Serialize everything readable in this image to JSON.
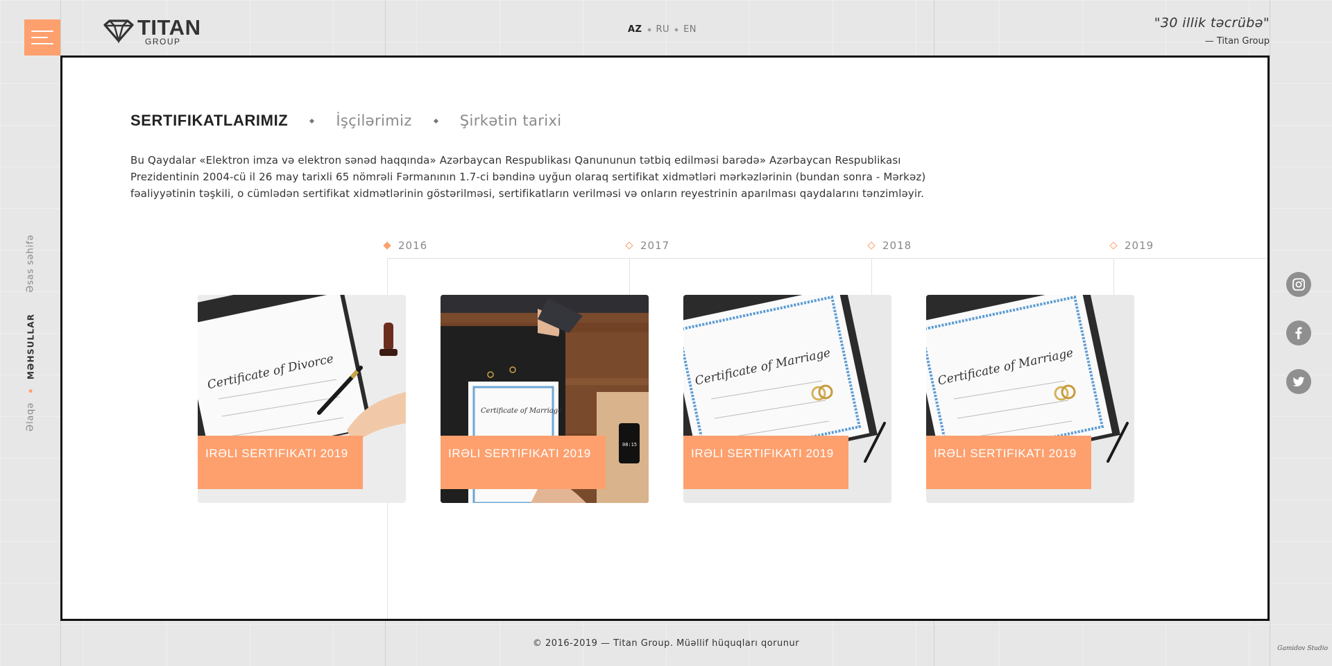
{
  "header": {
    "logo_main": "TITAN",
    "logo_sub": "GROUP",
    "languages": [
      {
        "code": "AZ",
        "active": true
      },
      {
        "code": "RU",
        "active": false
      },
      {
        "code": "EN",
        "active": false
      }
    ],
    "quote": "\"30 illik təcrübə\"",
    "quote_author": "— Titan Group"
  },
  "side_nav": {
    "items": [
      "Əsas səhifə",
      "MƏHSULLAR",
      "Əlaqə"
    ],
    "active_index": 1
  },
  "tabs": [
    "SERTIFIKATLARIMIZ",
    "İşçilərimiz",
    "Şirkətin tarixi"
  ],
  "description": "Bu Qaydalar «Elektron imza və elektron sənəd haqqında» Azərbaycan Respublikası Qanununun tətbiq edilməsi barədə» Azərbaycan Respublikası Prezidentinin 2004-cü il 26 may tarixli 65 nömrəli Fərmanının 1.7-ci bəndinə uyğun olaraq sertifikat xidmətləri mərkəzlərinin (bundan sonra - Mərkəz) fəaliyyətinin təşkili, o cümlədən sertifikat xidmətlərinin göstərilməsi, sertifikatların verilməsi və onların reyestrinin aparılması qaydalarını tənzimləyir.",
  "timeline": {
    "years": [
      "2016",
      "2017",
      "2018",
      "2019"
    ],
    "cards": [
      {
        "title": "IRƏLI SERTIFIKATI 2019",
        "image": "certificate-of-divorce-photo"
      },
      {
        "title": "IRƏLI SERTIFIKATI 2019",
        "image": "handover-desk-photo"
      },
      {
        "title": "IRƏLI SERTIFIKATI 2019",
        "image": "certificate-of-marriage-photo"
      },
      {
        "title": "IRƏLI SERTIFIKATI 2019",
        "image": "certificate-of-marriage-photo"
      }
    ]
  },
  "social": [
    "instagram-icon",
    "facebook-icon",
    "twitter-icon"
  ],
  "footer": "© 2016-2019 — Titan Group. Müəllif hüquqları qorunur",
  "studio": "Gamidov Studio",
  "colors": {
    "accent": "#fda06e",
    "panel_border": "#111111",
    "background": "#e7e7e7"
  }
}
